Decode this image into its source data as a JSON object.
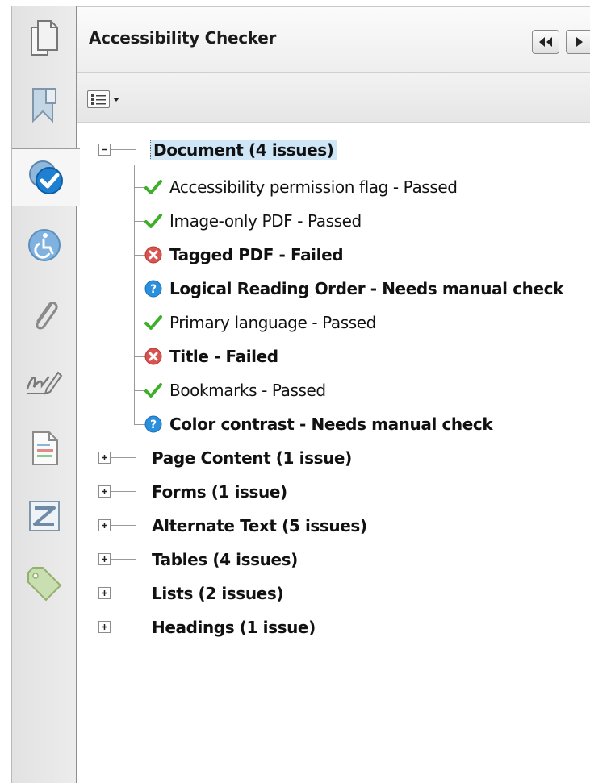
{
  "panel": {
    "title": "Accessibility Checker"
  },
  "navigation": [
    {
      "icon": "pages-icon"
    },
    {
      "icon": "bookmark-icon"
    },
    {
      "icon": "accessibility-check-icon",
      "active": true
    },
    {
      "icon": "accessibility-icon"
    },
    {
      "icon": "attachment-paperclip-icon"
    },
    {
      "icon": "signature-icon"
    },
    {
      "icon": "content-document-icon"
    },
    {
      "icon": "order-icon"
    },
    {
      "icon": "tag-icon"
    }
  ],
  "header_buttons": [
    {
      "icon": "rewind-icon"
    },
    {
      "icon": "play-right-icon"
    }
  ],
  "toolbar": {
    "options_icon": "list-options-icon"
  },
  "tree": {
    "document": {
      "label": "Document (4 issues)",
      "expanded": true,
      "items": [
        {
          "label": "Accessibility permission flag - Passed",
          "status": "passed"
        },
        {
          "label": "Image-only PDF - Passed",
          "status": "passed"
        },
        {
          "label": "Tagged PDF - Failed",
          "status": "failed"
        },
        {
          "label": "Logical Reading Order - Needs manual check",
          "status": "manual"
        },
        {
          "label": "Primary language - Passed",
          "status": "passed"
        },
        {
          "label": "Title - Failed",
          "status": "failed"
        },
        {
          "label": "Bookmarks - Passed",
          "status": "passed"
        },
        {
          "label": "Color contrast - Needs manual check",
          "status": "manual"
        }
      ]
    },
    "sections": [
      {
        "label": "Page Content (1 issue)"
      },
      {
        "label": "Forms (1 issue)"
      },
      {
        "label": "Alternate Text (5 issues)"
      },
      {
        "label": "Tables (4 issues)"
      },
      {
        "label": "Lists (2 issues)"
      },
      {
        "label": "Headings (1 issue)"
      }
    ]
  },
  "colors": {
    "passed": "#3fae2a",
    "failed": "#d9534f",
    "manual": "#2a8fdc",
    "selection": "#cfe6f7"
  }
}
